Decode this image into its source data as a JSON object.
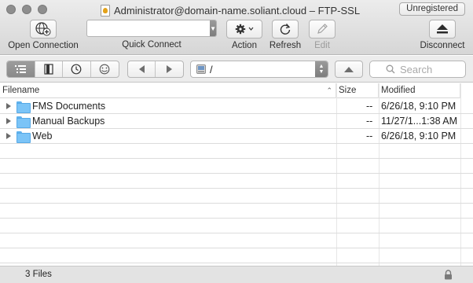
{
  "window": {
    "title": "Administrator@domain-name.soliant.cloud – FTP-SSL",
    "unregistered_label": "Unregistered"
  },
  "toolbar": {
    "open_connection": "Open Connection",
    "quick_connect": "Quick Connect",
    "quick_connect_value": "",
    "action": "Action",
    "refresh": "Refresh",
    "edit": "Edit",
    "disconnect": "Disconnect"
  },
  "navbar": {
    "path": "/",
    "search_placeholder": "Search"
  },
  "table": {
    "columns": [
      "Filename",
      "Size",
      "Modified"
    ],
    "rows": [
      {
        "name": "FMS Documents",
        "size": "--",
        "modified": "6/26/18, 9:10 PM"
      },
      {
        "name": "Manual Backups",
        "size": "--",
        "modified": "11/27/1...1:38 AM"
      },
      {
        "name": "Web",
        "size": "--",
        "modified": "6/26/18, 9:10 PM"
      }
    ]
  },
  "status": {
    "file_count": "3 Files"
  },
  "icons": {
    "open_connection": "globe-plus-icon",
    "action": "gear-icon",
    "refresh": "refresh-icon",
    "edit": "pencil-icon",
    "disconnect": "eject-icon"
  }
}
